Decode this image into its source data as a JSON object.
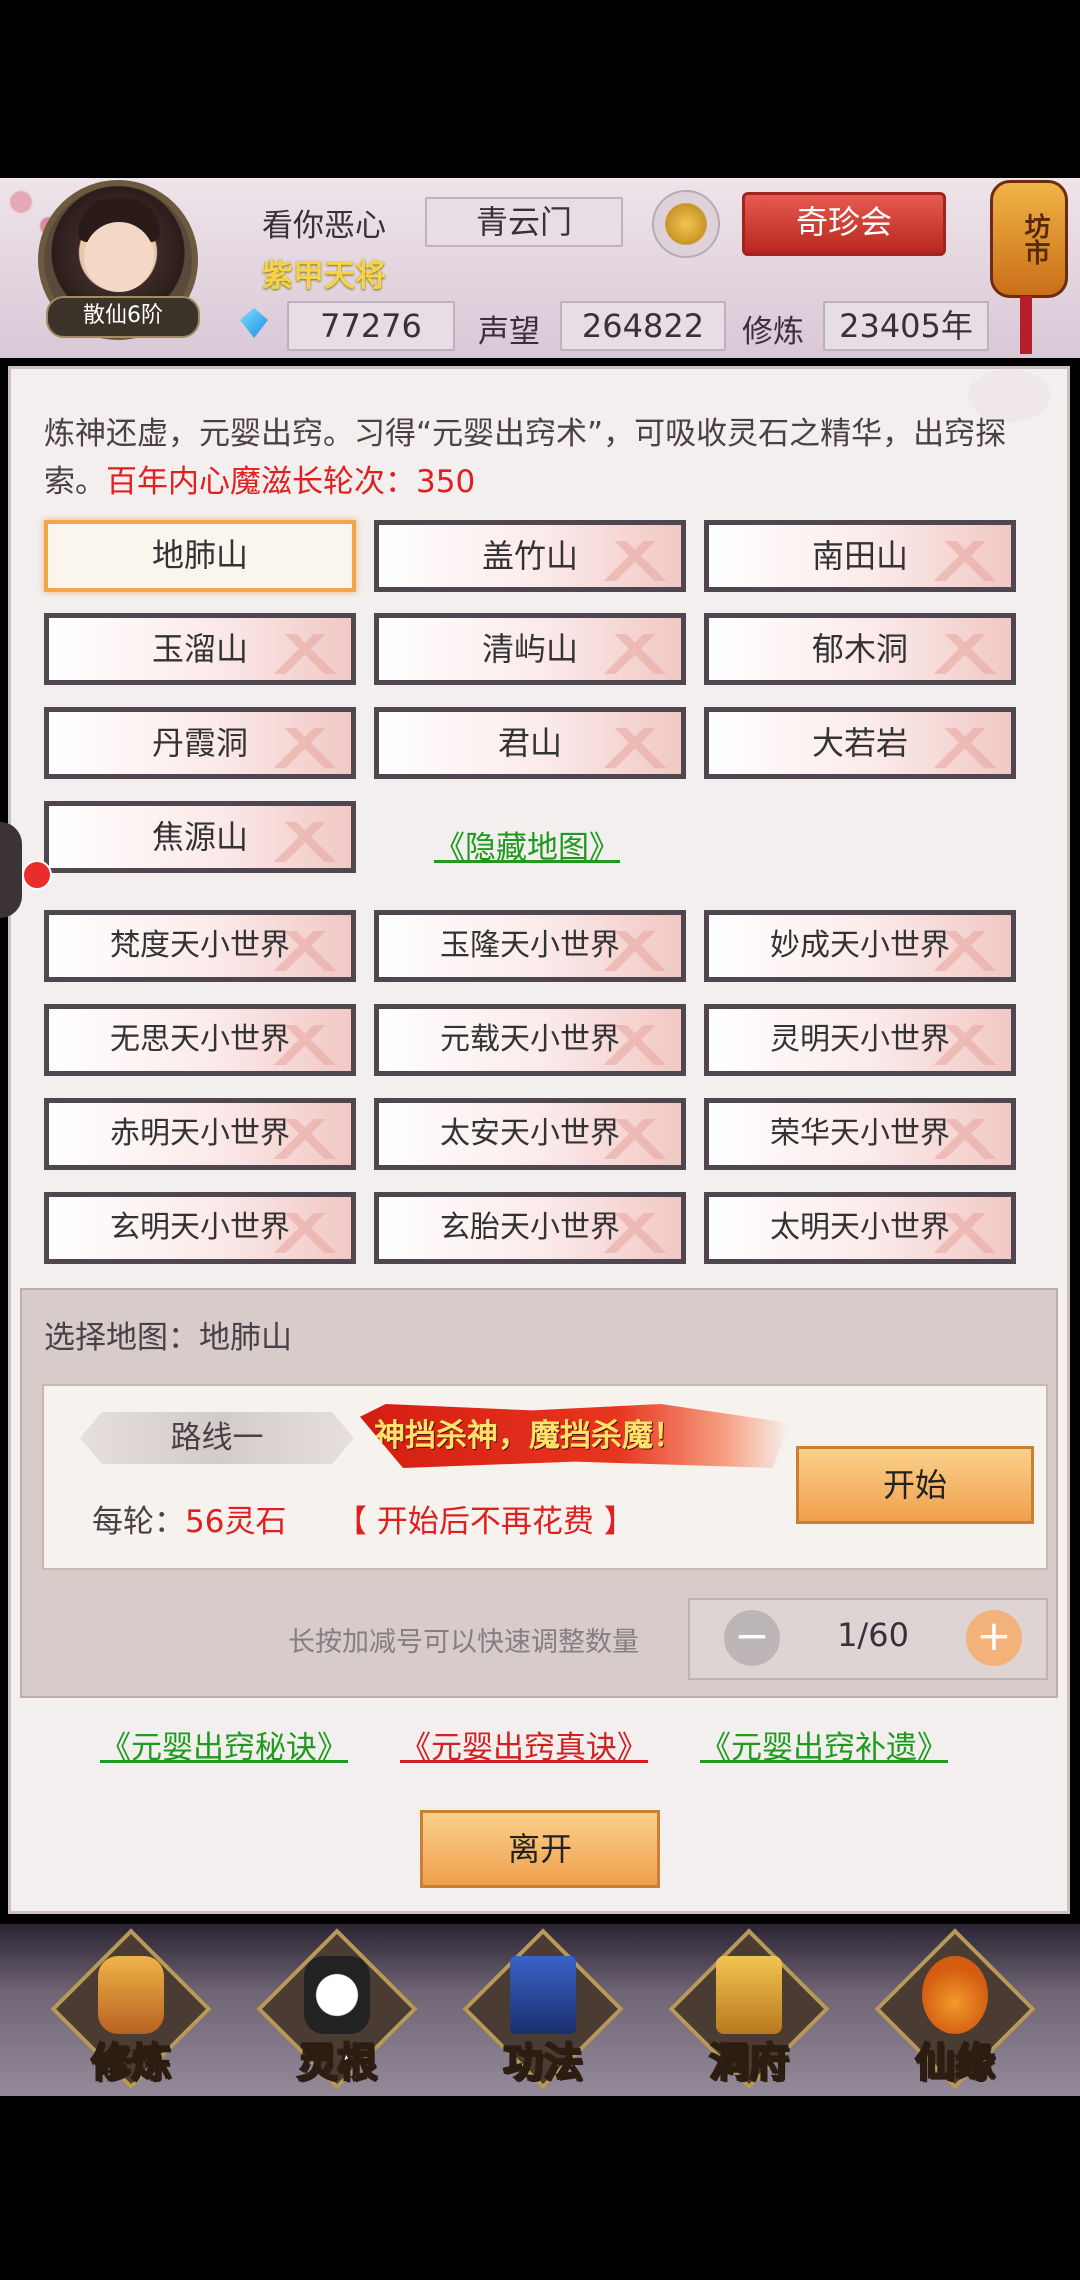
{
  "header": {
    "avatar_rank": "散仙6阶",
    "username": "看你恶心",
    "title": "紫甲天将",
    "sect": "青云门",
    "treasure_button": "奇珍会",
    "market_lantern": "坊市",
    "spirit_stones": "77276",
    "reputation_label": "声望",
    "reputation": "264822",
    "cultivation_label": "修炼",
    "cultivation": "23405年"
  },
  "intro": {
    "text": "炼神还虚，元婴出窍。习得“元婴出窍术”，可吸收灵石之精华，出窍探索。",
    "highlight": "百年内心魔滋长轮次：350"
  },
  "maps": {
    "regular": [
      "地肺山",
      "盖竹山",
      "南田山",
      "玉溜山",
      "清屿山",
      "郁木洞",
      "丹霞洞",
      "君山",
      "大若岩",
      "焦源山"
    ],
    "hidden_link": "《隐藏地图》",
    "worlds": [
      "梵度天小世界",
      "玉隆天小世界",
      "妙成天小世界",
      "无思天小世界",
      "元载天小世界",
      "灵明天小世界",
      "赤明天小世界",
      "太安天小世界",
      "荣华天小世界",
      "玄明天小世界",
      "玄胎天小世界",
      "太明天小世界"
    ],
    "selected": "地肺山"
  },
  "selection": {
    "label": "选择地图：地肺山",
    "route": "路线一",
    "banner": "神挡杀神，魔挡杀魔！",
    "start_button": "开始",
    "cost_prefix": "每轮：",
    "cost_value": "56灵石",
    "no_fee_note": "【 开始后不再花费 】",
    "hint": "长按加减号可以快速调整数量",
    "quantity": "1/60",
    "minus": "−",
    "plus": "+"
  },
  "links": {
    "secret": "《元婴出窍秘诀》",
    "true": "《元婴出窍真诀》",
    "supplement": "《元婴出窍补遗》"
  },
  "leave_button": "离开",
  "nav": {
    "items": [
      "修炼",
      "灵根",
      "功法",
      "洞府",
      "仙缘"
    ]
  },
  "colors": {
    "accent_red": "#e02020",
    "link_green": "#1f9a1f",
    "link_red": "#d21f1f",
    "button_orange": "#f0a04d",
    "title_yellow": "#f5d34a"
  }
}
